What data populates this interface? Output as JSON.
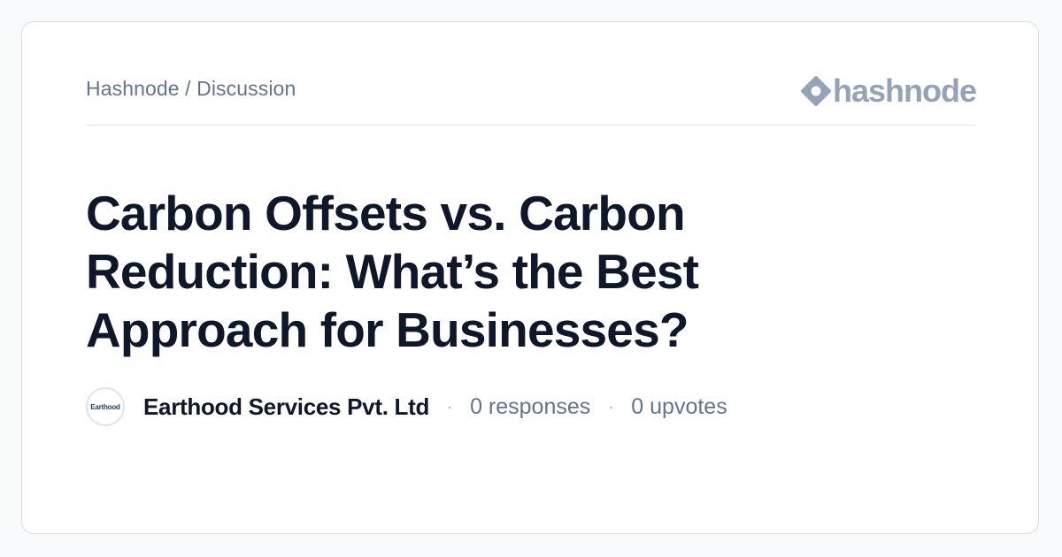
{
  "breadcrumb": "Hashnode / Discussion",
  "logo": {
    "text": "hashnode",
    "icon": "hashnode-diamond-icon",
    "color": "#94a3b8"
  },
  "post": {
    "title": "Carbon Offsets vs. Carbon Reduction: What’s the Best Approach for Businesses?"
  },
  "author": {
    "avatar_text": "Earthood",
    "name": "Earthood Services Pvt. Ltd"
  },
  "stats": {
    "separator": "·",
    "responses": "0 responses",
    "upvotes": "0 upvotes"
  },
  "colors": {
    "title": "#0f172a",
    "muted": "#64748b",
    "background": "#f8fafc",
    "card": "#ffffff"
  }
}
